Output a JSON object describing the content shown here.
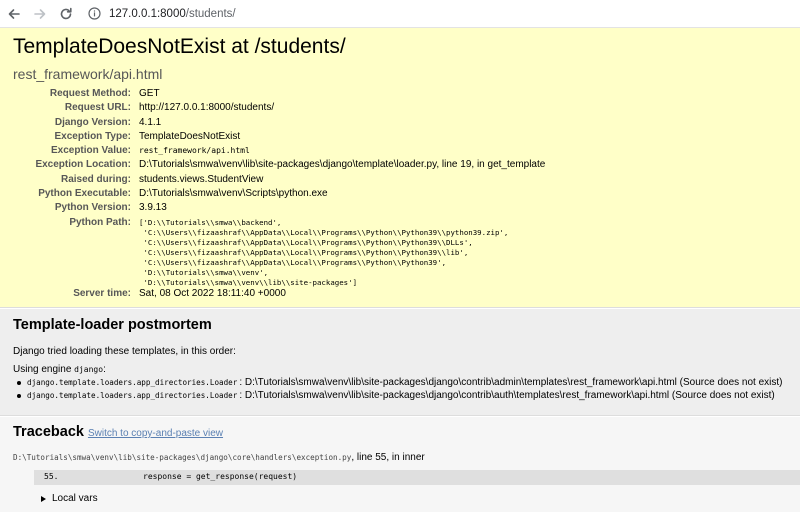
{
  "browser": {
    "url_host": "127.0.0.1:8000",
    "url_path": "/students/"
  },
  "summary": {
    "title": "TemplateDoesNotExist at /students/",
    "subtitle": "rest_framework/api.html",
    "meta": [
      {
        "key": "Request Method:",
        "value": "GET"
      },
      {
        "key": "Request URL:",
        "value": "http://127.0.0.1:8000/students/"
      },
      {
        "key": "Django Version:",
        "value": "4.1.1"
      },
      {
        "key": "Exception Type:",
        "value": "TemplateDoesNotExist"
      },
      {
        "key": "Exception Value:",
        "value": "rest_framework/api.html"
      },
      {
        "key": "Exception Location:",
        "value": "D:\\Tutorials\\smwa\\venv\\lib\\site-packages\\django\\template\\loader.py, line 19, in get_template"
      },
      {
        "key": "Raised during:",
        "value": "students.views.StudentView"
      },
      {
        "key": "Python Executable:",
        "value": "D:\\Tutorials\\smwa\\venv\\Scripts\\python.exe"
      },
      {
        "key": "Python Version:",
        "value": "3.9.13"
      },
      {
        "key": "Python Path:"
      },
      {
        "key": "Server time:",
        "value": "Sat, 08 Oct 2022 18:11:40 +0000"
      }
    ],
    "python_path": [
      "['D:\\\\Tutorials\\\\smwa\\\\backend',",
      " 'C:\\\\Users\\\\fizaashraf\\\\AppData\\\\Local\\\\Programs\\\\Python\\\\Python39\\\\python39.zip',",
      " 'C:\\\\Users\\\\fizaashraf\\\\AppData\\\\Local\\\\Programs\\\\Python\\\\Python39\\\\DLLs',",
      " 'C:\\\\Users\\\\fizaashraf\\\\AppData\\\\Local\\\\Programs\\\\Python\\\\Python39\\\\lib',",
      " 'C:\\\\Users\\\\fizaashraf\\\\AppData\\\\Local\\\\Programs\\\\Python\\\\Python39',",
      " 'D:\\\\Tutorials\\\\smwa\\\\venv',",
      " 'D:\\\\Tutorials\\\\smwa\\\\venv\\\\lib\\\\site-packages']"
    ]
  },
  "postmortem": {
    "title": "Template-loader postmortem",
    "intro": "Django tried loading these templates, in this order:",
    "engine_label": "Using engine ",
    "engine_name": "django",
    "engine_suffix": ":",
    "items": [
      {
        "loader": "django.template.loaders.app_directories.Loader",
        "path": ": D:\\Tutorials\\smwa\\venv\\lib\\site-packages\\django\\contrib\\admin\\templates\\rest_framework\\api.html (Source does not exist)"
      },
      {
        "loader": "django.template.loaders.app_directories.Loader",
        "path": ": D:\\Tutorials\\smwa\\venv\\lib\\site-packages\\django\\contrib\\auth\\templates\\rest_framework\\api.html (Source does not exist)"
      }
    ]
  },
  "traceback": {
    "title": "Traceback",
    "switch_link": "Switch to copy-and-paste view",
    "file": "D:\\Tutorials\\smwa\\venv\\lib\\site-packages\\django\\core\\handlers\\exception.py",
    "file_suffix": ", line 55, in inner",
    "line_no": "55.",
    "line_src": "response = get_response(request)",
    "local_vars": "Local vars"
  }
}
